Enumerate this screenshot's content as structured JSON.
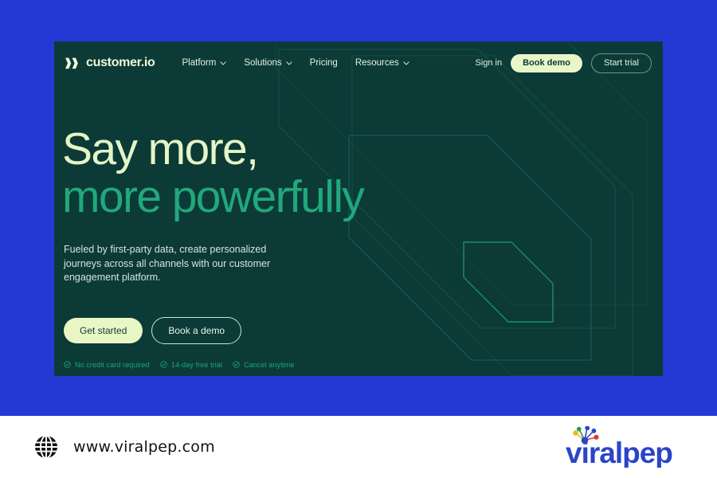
{
  "page": {
    "backdrop_color": "#2438d4",
    "hero_bg_color": "#0c3a37",
    "accent_cream": "#e9f7c5",
    "accent_green": "#21a87c"
  },
  "hero": {
    "nav": {
      "logo_text": "customer.io",
      "logo_icon": "customerio-logo-mark",
      "links": [
        {
          "label": "Platform",
          "has_caret": true,
          "icon": "chevron-down-icon"
        },
        {
          "label": "Solutions",
          "has_caret": true,
          "icon": "chevron-down-icon"
        },
        {
          "label": "Pricing",
          "has_caret": false,
          "icon": ""
        },
        {
          "label": "Resources",
          "has_caret": true,
          "icon": "chevron-down-icon"
        }
      ],
      "sign_in": "Sign in",
      "book_demo": "Book demo",
      "start_trial": "Start trial"
    },
    "headline_line1": "Say more,",
    "headline_line2": "more powerfully",
    "subheadline": "Fueled by first-party data, create personalized journeys across all channels with our customer engagement platform.",
    "cta_primary": "Get started",
    "cta_secondary": "Book a demo",
    "ticks": [
      {
        "label": "No credit card required",
        "icon": "check-circle-icon"
      },
      {
        "label": "14-day free trial",
        "icon": "check-circle-icon"
      },
      {
        "label": "Cancel anytime",
        "icon": "check-circle-icon"
      }
    ]
  },
  "footer": {
    "globe_icon": "globe-icon",
    "url": "www.viralpep.com",
    "brand_name": "viralpep",
    "brand_icon": "viralpep-burst-icon",
    "brand_color": "#2b44c8"
  }
}
